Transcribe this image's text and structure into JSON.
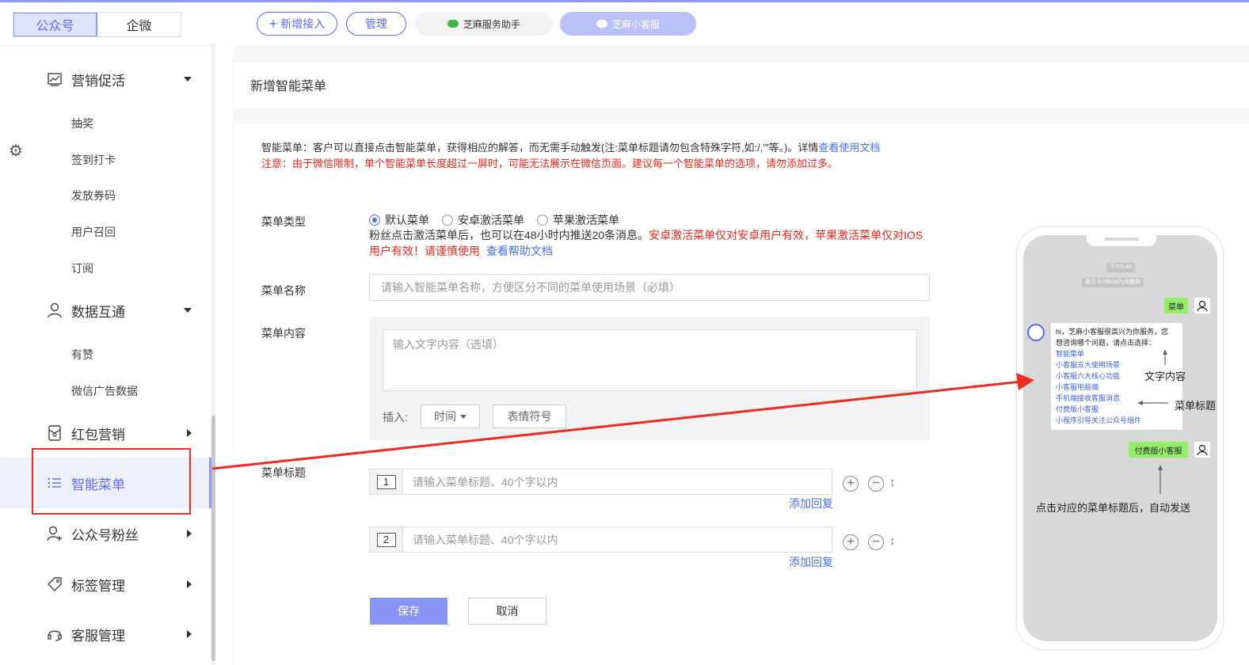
{
  "sidebar": {
    "segment": {
      "left": "公众号",
      "right": "企微"
    },
    "groups": {
      "marketing": "营销促活",
      "data": "数据互通",
      "redpacket": "红包营销",
      "smart_menu": "智能菜单",
      "fans": "公众号粉丝",
      "tags": "标签管理",
      "service": "客服管理"
    },
    "marketing_items": [
      "抽奖",
      "签到打卡",
      "发放券码",
      "用户召回",
      "订阅"
    ],
    "data_items": [
      "有赞",
      "微信广告数据"
    ]
  },
  "topbar": {
    "add_access": "新增接入",
    "manage": "管理",
    "account1": "芝麻服务助手",
    "account2": "芝麻小客服"
  },
  "page": {
    "title": "新增智能菜单",
    "desc_prefix": "智能菜单：客户可以直接点击智能菜单，获得相应的解答，而无需手动触发(注:菜单标题请勿包含特殊字符,如:/,'\"等。)。详情",
    "desc_link": "查看使用文档",
    "notice": "注意：由于微信限制，单个智能菜单长度超过一屏时，可能无法展示在微信页面。建议每一个智能菜单的选项，请勿添加过多。"
  },
  "form": {
    "type_label": "菜单类型",
    "type_options": [
      "默认菜单",
      "安卓激活菜单",
      "苹果激活菜单"
    ],
    "type_selected": "默认菜单",
    "type_note_plain": "粉丝点击激活菜单后，也可以在48小时内推送20条消息。",
    "type_note_red1": "安卓激活菜单仅对安卓用户有效，苹果激活菜单仅对IOS",
    "type_note_red2": "用户有效！请谨慎使用",
    "type_note_link": "查看帮助文档",
    "name_label": "菜单名称",
    "name_placeholder": "请输入智能菜单名称，方便区分不同的菜单使用场景（必填）",
    "content_label": "菜单内容",
    "content_placeholder": "输入文字内容（选填）",
    "insert_label": "插入:",
    "insert_time": "时间",
    "insert_emoji": "表情符号",
    "titles_label": "菜单标题",
    "titles": [
      {
        "num": "1",
        "placeholder": "请输入菜单标题、40个字以内",
        "add_reply": "添加回复"
      },
      {
        "num": "2",
        "placeholder": "请输入菜单标题、40个字以内",
        "add_reply": "添加回复"
      }
    ],
    "save": "保存",
    "cancel": "取消"
  },
  "phone": {
    "time": "下午3:48",
    "system": "晏贝卡Official为你服务",
    "user_msg1": "菜单",
    "bot_intro": "hi，芝麻小客服很高兴为你服务，您想咨询哪个问题，请点击选择：",
    "bot_links": [
      "智能菜单",
      "小客服五大使用场景",
      "小客服六大核心功能",
      "小客服电脑端",
      "手机端接收客服消息",
      "付费版小客服",
      "小程序引导关注公众号组件"
    ],
    "user_msg2": "付费版小客服",
    "annotation_content": "文字内容",
    "annotation_title": "菜单标题",
    "annotation_bottom": "点击对应的菜单标题后，自动发送"
  },
  "colors": {
    "accent": "#5a6bf0",
    "link": "#4a6cf7",
    "warn": "#f0241b",
    "save_btn": "#8794f4",
    "arrow": "#f02a20"
  }
}
